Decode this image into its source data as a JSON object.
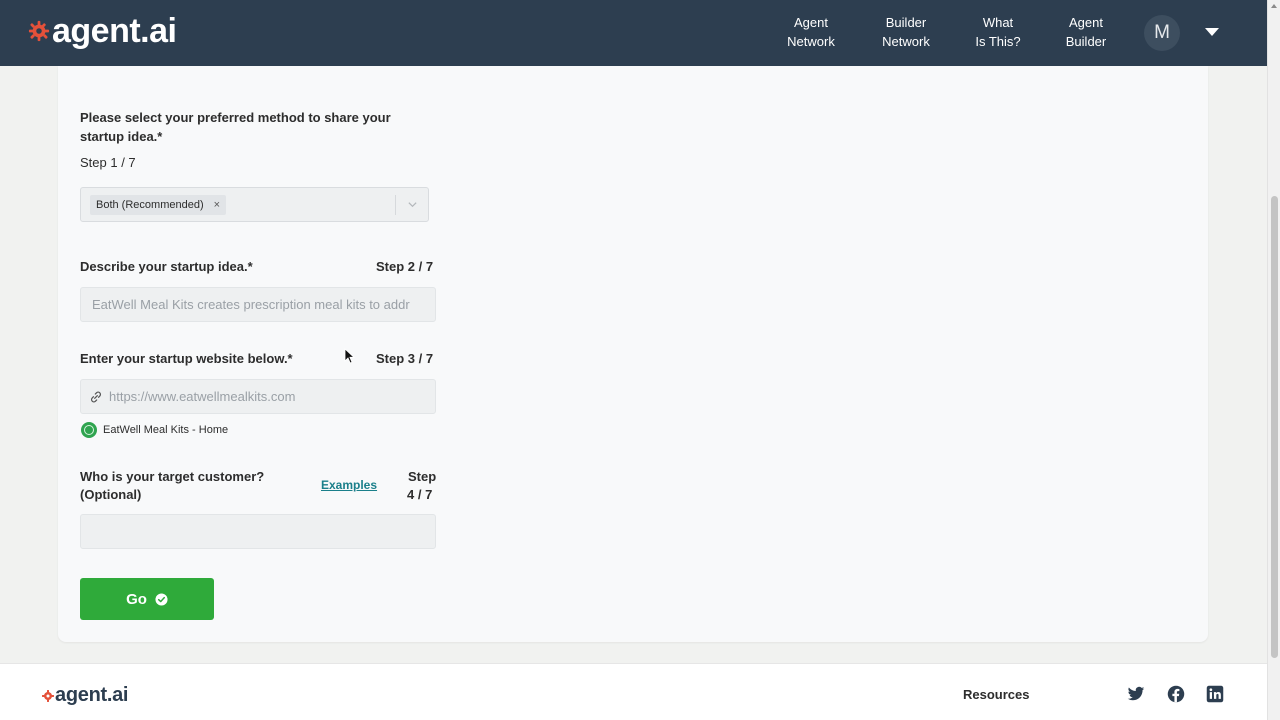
{
  "header": {
    "logo_text": "agent.ai",
    "nav": [
      {
        "line1": "Agent",
        "line2": "Network"
      },
      {
        "line1": "Builder",
        "line2": "Network"
      },
      {
        "line1": "What",
        "line2": "Is This?"
      },
      {
        "line1": "Agent",
        "line2": "Builder"
      }
    ],
    "avatar_initial": "M"
  },
  "form": {
    "q1": {
      "label_line1": "Please select your preferred method to share your",
      "label_line2": "startup idea.*",
      "step": "Step 1 / 7",
      "selected_value": "Both (Recommended)",
      "chip_remove": "×"
    },
    "q2": {
      "label": "Describe your startup idea.*",
      "step": "Step 2 / 7",
      "value": "EatWell Meal Kits creates prescription meal kits to addr"
    },
    "q3": {
      "label": "Enter your startup website below.*",
      "step": "Step 3 / 7",
      "value": "https://www.eatwellmealkits.com",
      "site_title": "EatWell Meal Kits - Home"
    },
    "q4": {
      "label_line1": "Who is your target customer?",
      "label_line2": "(Optional)",
      "examples_link": "Examples",
      "step_line1": "Step",
      "step_line2": "4 / 7",
      "value": ""
    },
    "go_label": "Go"
  },
  "footer": {
    "logo_text": "agent.ai",
    "resources_heading": "Resources",
    "social_icons": [
      "twitter-icon",
      "facebook-icon",
      "linkedin-icon"
    ]
  },
  "colors": {
    "header_bg": "#2d3e50",
    "go_button": "#2faa3a",
    "link": "#1a7f8a"
  }
}
